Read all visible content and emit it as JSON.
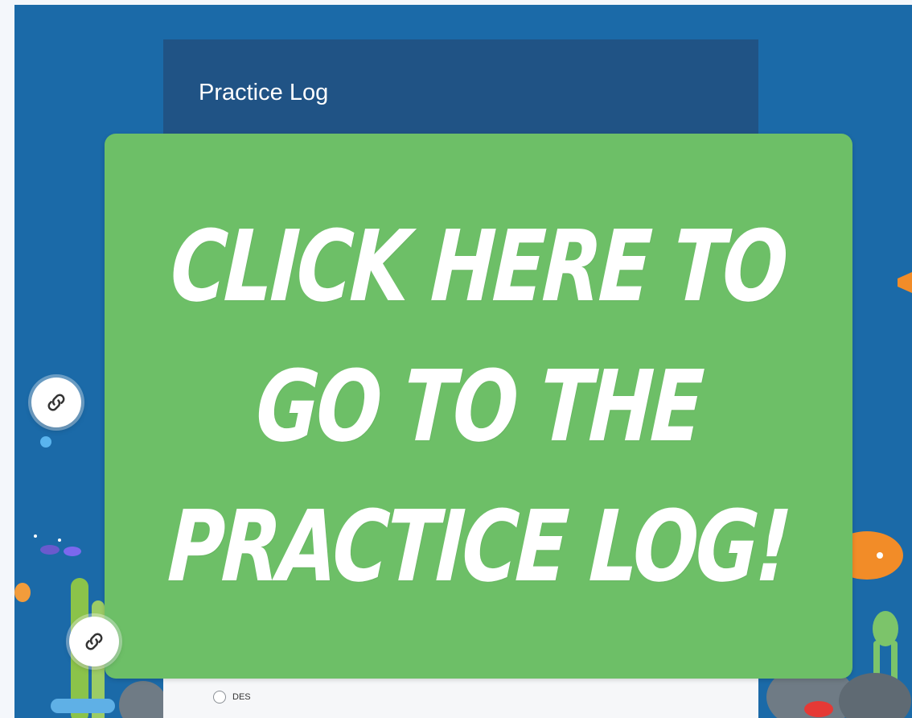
{
  "form": {
    "title": "Practice Log",
    "option_label": "DES"
  },
  "banner": {
    "lines": [
      "Click here to",
      "go to the",
      "Practice Log!"
    ]
  },
  "icons": {
    "link_1": "link-icon",
    "link_2": "link-icon"
  },
  "colors": {
    "background": "#1b6aa8",
    "form_header": "#205385",
    "banner": "#6dbf67",
    "text": "#ffffff"
  }
}
